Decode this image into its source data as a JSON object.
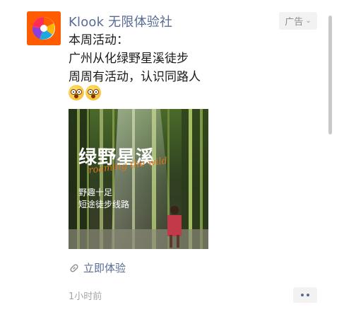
{
  "account": {
    "name": "Klook 无限体验社",
    "avatar_icon": "klook-logo-icon",
    "brand_color": "#ff5b00"
  },
  "ad_tag": {
    "label": "广告",
    "chevron_icon": "chevron-down-icon"
  },
  "post": {
    "lines": [
      "本周活动：",
      "广州从化绿野星溪徒步",
      "周周有活动，认识同路人"
    ],
    "emojis": [
      "astonished-face-icon",
      "astonished-face-icon"
    ]
  },
  "image": {
    "title": "绿野星溪",
    "script_text": "roaming the wild",
    "subtitle_lines": [
      "野趣十足",
      "短途徒步线路"
    ]
  },
  "cta": {
    "icon": "link-icon",
    "label": "立即体验"
  },
  "meta": {
    "time": "1小时前",
    "more_icon": "more-options-icon"
  },
  "colors": {
    "link": "#576b95",
    "text": "#1a1a1a",
    "muted": "#a6a6a6"
  }
}
